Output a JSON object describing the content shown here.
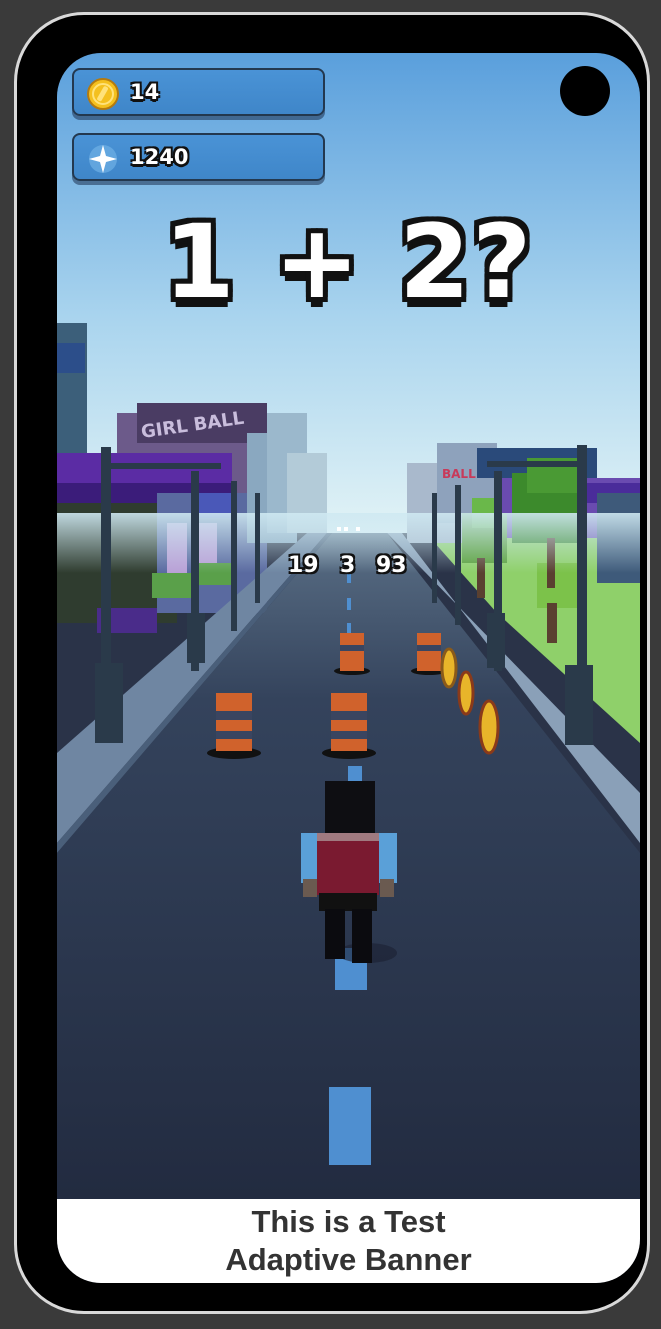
{
  "hud": {
    "coins": {
      "icon": "coin-icon",
      "value": "14"
    },
    "score": {
      "icon": "sparkle-icon",
      "value": "1240"
    }
  },
  "question": {
    "text": "1 + 2?"
  },
  "answers": [
    "19",
    "3",
    "93"
  ],
  "banner": {
    "line1": "This is a Test",
    "line2": "Adaptive Banner"
  },
  "colors": {
    "sky_top": "#5a9fdc",
    "sky_bottom": "#d3ecf4",
    "road": "#23304a",
    "hud_panel": "#4a93d6",
    "cone_orange": "#d0622c",
    "coin_gold": "#e8b52a",
    "grass": "#8fd06a"
  }
}
